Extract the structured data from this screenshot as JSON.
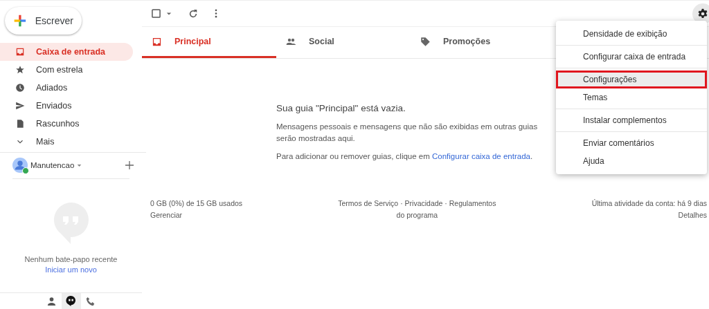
{
  "compose_button": "Escrever",
  "nav": [
    {
      "label": "Caixa de entrada",
      "kind": "inbox",
      "selected": true
    },
    {
      "label": "Com estrela",
      "kind": "star",
      "selected": false
    },
    {
      "label": "Adiados",
      "kind": "clock",
      "selected": false
    },
    {
      "label": "Enviados",
      "kind": "send",
      "selected": false
    },
    {
      "label": "Rascunhos",
      "kind": "draft",
      "selected": false
    },
    {
      "label": "Mais",
      "kind": "more",
      "selected": false
    }
  ],
  "account": {
    "name": "Manutencao",
    "online": true
  },
  "chat": {
    "empty_text": "Nenhum bate-papo recente",
    "start_link": "Iniciar um novo"
  },
  "chat_tabs": [
    {
      "kind": "contacts",
      "selected": false
    },
    {
      "kind": "chat",
      "selected": true
    },
    {
      "kind": "phone",
      "selected": false
    }
  ],
  "tabs": [
    {
      "label": "Principal",
      "kind": "inbox",
      "selected": true
    },
    {
      "label": "Social",
      "kind": "people",
      "selected": false
    },
    {
      "label": "Promoções",
      "kind": "tag",
      "selected": false
    }
  ],
  "empty": {
    "title": "Sua guia \"Principal\" está vazia.",
    "body": "Mensagens pessoais e mensagens que não são exibidas em outras guias serão mostradas aqui.",
    "hint": "Para adicionar ou remover guias, clique em",
    "hint_link": "Configurar caixa de entrada",
    "hint_end": "."
  },
  "footer": {
    "storage": "0 GB (0%) de 15 GB usados",
    "manage": "Gerenciar",
    "terms": "Termos de Serviço",
    "privacy": "Privacidade",
    "program": "Regulamentos do programa",
    "separator": "·",
    "activity": "Última atividade da conta: há 9 dias",
    "details": "Detalhes"
  },
  "settings_menu": [
    [
      {
        "label": "Densidade de exibição",
        "selected": false
      }
    ],
    [
      {
        "label": "Configurar caixa de entrada",
        "selected": false
      }
    ],
    [
      {
        "label": "Configurações",
        "selected": true
      },
      {
        "label": "Temas",
        "selected": false
      }
    ],
    [
      {
        "label": "Instalar complementos",
        "selected": false
      }
    ],
    [
      {
        "label": "Enviar comentários",
        "selected": false
      },
      {
        "label": "Ajuda",
        "selected": false
      }
    ]
  ]
}
